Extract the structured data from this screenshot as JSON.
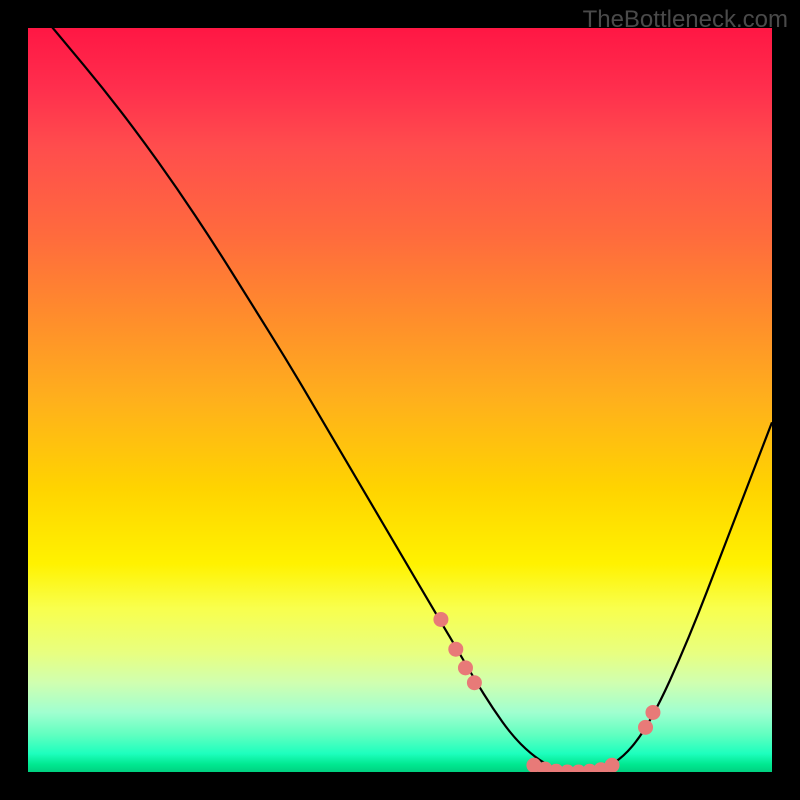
{
  "watermark": "TheBottleneck.com",
  "chart_data": {
    "type": "line",
    "title": "",
    "xlabel": "",
    "ylabel": "",
    "xlim": [
      0,
      100
    ],
    "ylim": [
      0,
      100
    ],
    "series": [
      {
        "name": "bottleneck-curve",
        "x": [
          0,
          5,
          10,
          15,
          20,
          25,
          30,
          35,
          40,
          45,
          50,
          55,
          57.5,
          60,
          62.5,
          65,
          67.5,
          70,
          72.5,
          75,
          77.5,
          80,
          82.5,
          85,
          87.5,
          90,
          92.5,
          95,
          97.5,
          100
        ],
        "y": [
          104,
          98,
          92,
          85.5,
          78.5,
          71,
          63,
          55,
          46.5,
          38,
          29.5,
          21,
          16.8,
          12.5,
          8.5,
          5,
          2.5,
          0.8,
          0,
          0,
          0.5,
          2,
          5,
          9.5,
          15,
          21,
          27.5,
          34,
          40.5,
          47
        ]
      }
    ],
    "markers": [
      {
        "x": 55.5,
        "y": 20.5
      },
      {
        "x": 57.5,
        "y": 16.5
      },
      {
        "x": 58.8,
        "y": 14
      },
      {
        "x": 60,
        "y": 12
      },
      {
        "x": 68,
        "y": 0.9
      },
      {
        "x": 69.5,
        "y": 0.4
      },
      {
        "x": 71,
        "y": 0.1
      },
      {
        "x": 72.5,
        "y": 0
      },
      {
        "x": 74,
        "y": 0
      },
      {
        "x": 75.5,
        "y": 0.1
      },
      {
        "x": 77,
        "y": 0.3
      },
      {
        "x": 78.5,
        "y": 0.9
      },
      {
        "x": 83,
        "y": 6
      },
      {
        "x": 84,
        "y": 8
      }
    ],
    "gradient_stops": [
      {
        "pos": 0,
        "color": "#ff1744"
      },
      {
        "pos": 50,
        "color": "#ffd400"
      },
      {
        "pos": 82,
        "color": "#f8ff4d"
      },
      {
        "pos": 100,
        "color": "#00d080"
      }
    ]
  }
}
